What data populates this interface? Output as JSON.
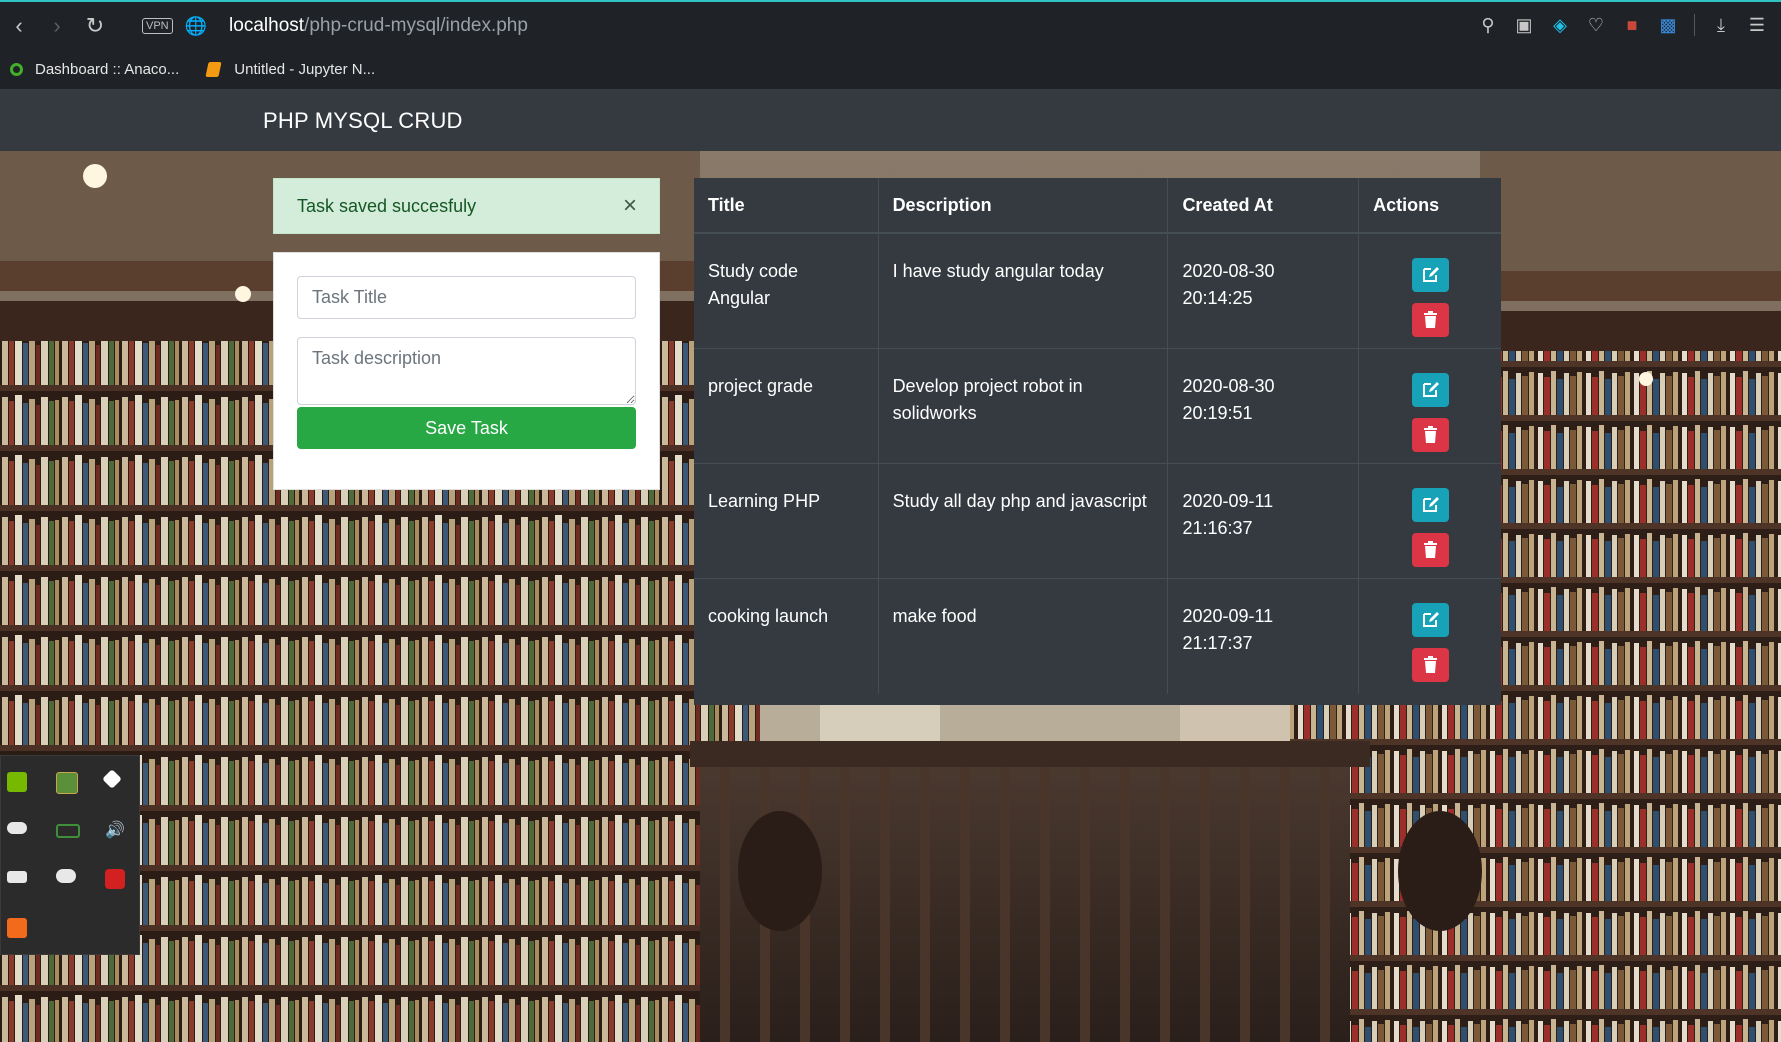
{
  "browser": {
    "vpn_label": "VPN",
    "url_host": "localhost",
    "url_path": "/php-crud-mysql/index.php",
    "bookmarks": [
      {
        "label": "Dashboard :: Anaco..."
      },
      {
        "label": "Untitled - Jupyter N..."
      }
    ]
  },
  "navbar": {
    "brand": "PHP MYSQL CRUD"
  },
  "alert": {
    "message": "Task saved succesfuly",
    "close_symbol": "×"
  },
  "form": {
    "title_placeholder": "Task Title",
    "description_placeholder": "Task description",
    "save_label": "Save Task"
  },
  "table": {
    "headers": [
      "Title",
      "Description",
      "Created At",
      "Actions"
    ],
    "rows": [
      {
        "title": "Study code Angular",
        "description": "I have study angular today",
        "date": "2020-08-30",
        "time": "20:14:25"
      },
      {
        "title": "project grade",
        "description": "Develop project robot in solidworks",
        "date": "2020-08-30",
        "time": "20:19:51"
      },
      {
        "title": "Learning PHP",
        "description": "Study all day php and javascript",
        "date": "2020-09-11",
        "time": "21:16:37"
      },
      {
        "title": "cooking launch",
        "description": "make food",
        "date": "2020-09-11",
        "time": "21:17:37"
      }
    ]
  },
  "colors": {
    "navbar": "#343a40",
    "alert_bg": "#d4edda",
    "save_button": "#28a745",
    "edit_button": "#17a2b8",
    "delete_button": "#dc3545"
  },
  "icons": [
    "back-icon",
    "forward-icon",
    "reload-icon",
    "globe-icon",
    "search-icon",
    "camera-icon",
    "shield-icon",
    "heart-icon",
    "cube-icon",
    "robot-icon",
    "download-icon",
    "settings-icon",
    "edit-icon",
    "trash-icon",
    "close-icon"
  ]
}
